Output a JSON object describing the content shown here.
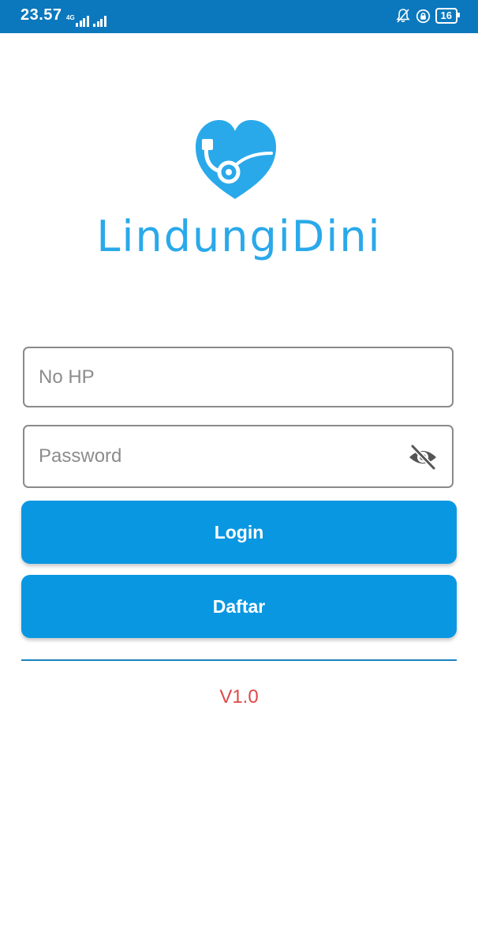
{
  "status_bar": {
    "time": "23.57",
    "network": "4G",
    "battery": "16",
    "icons": [
      "signal-icon",
      "signal-icon",
      "notifications-muted-icon",
      "vpn-lock-icon",
      "battery-icon"
    ]
  },
  "app": {
    "name": "LindungiDini",
    "logo_icon": "heart-stethoscope-icon"
  },
  "form": {
    "phone_placeholder": "No HP",
    "phone_value": "",
    "password_placeholder": "Password",
    "password_value": "",
    "password_toggle_icon": "eye-off-icon",
    "login_label": "Login",
    "register_label": "Daftar"
  },
  "footer": {
    "version": "V1.0"
  },
  "colors": {
    "status_bar": "#0b78bd",
    "brand": "#2aa9ea",
    "button": "#0a97e2",
    "version_text": "#e04848"
  }
}
